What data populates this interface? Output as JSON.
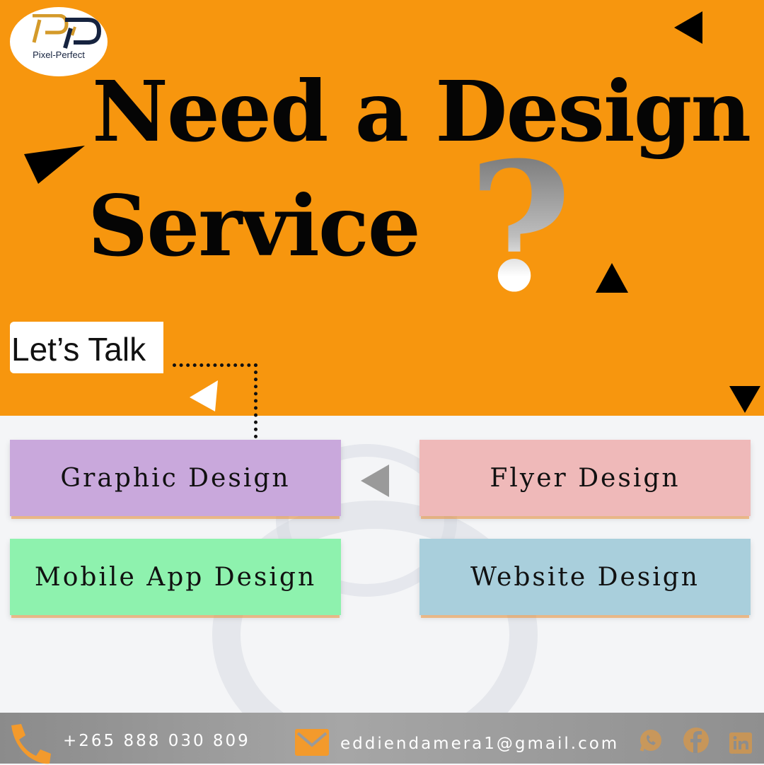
{
  "brand": {
    "name": "Pixel-Perfect",
    "logo_icon": "pp-monogram-icon"
  },
  "headline": {
    "line1": "Need a Design",
    "line2": "Service",
    "question_mark": "?"
  },
  "cta": {
    "label": "Let’s Talk"
  },
  "services": [
    {
      "label": "Graphic Design",
      "color": "#c9a8dc"
    },
    {
      "label": "Flyer Design",
      "color": "#efb9b9"
    },
    {
      "label": "Mobile App Design",
      "color": "#8ef2ae"
    },
    {
      "label": "Website Design",
      "color": "#a9cfdc"
    }
  ],
  "contact": {
    "phone": "+265 888 030 809",
    "email": "eddiendamera1@gmail.com",
    "icons": [
      "phone-icon",
      "mail-icon",
      "whatsapp-icon",
      "facebook-icon",
      "linkedin-icon"
    ]
  },
  "colors": {
    "accent": "#f7960e",
    "footer": "#9b9b9b",
    "icon_orange": "#f39a2c"
  }
}
